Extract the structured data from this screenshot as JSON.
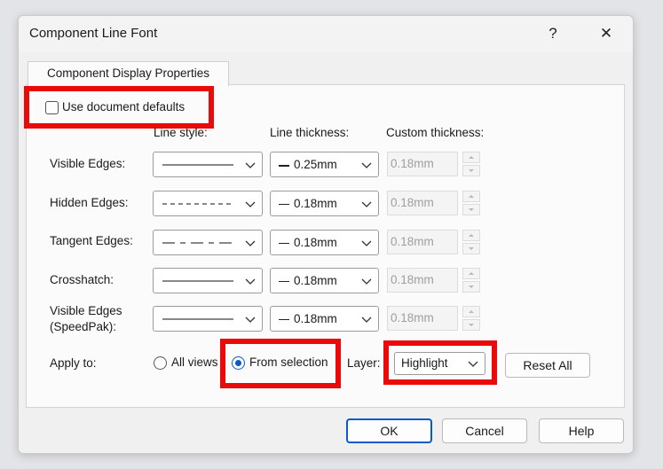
{
  "dialog": {
    "title": "Component Line Font",
    "help_glyph": "?",
    "close_glyph": "✕",
    "tab": "Component Display Properties",
    "use_defaults_label": "Use document defaults",
    "columns": {
      "line_style": "Line style:",
      "line_thickness": "Line thickness:",
      "custom_thickness": "Custom thickness:"
    },
    "rows": [
      {
        "label": "Visible Edges:",
        "style": "solid",
        "thickness": "0.25mm",
        "thick_mark": "thick",
        "custom": "0.18mm"
      },
      {
        "label": "Hidden Edges:",
        "style": "dashed",
        "thickness": "0.18mm",
        "thick_mark": "thin",
        "custom": "0.18mm"
      },
      {
        "label": "Tangent Edges:",
        "style": "dash-gap",
        "thickness": "0.18mm",
        "thick_mark": "thin",
        "custom": "0.18mm"
      },
      {
        "label": "Crosshatch:",
        "style": "solid",
        "thickness": "0.18mm",
        "thick_mark": "thin",
        "custom": "0.18mm"
      },
      {
        "label_line1": "Visible Edges",
        "label_line2": "(SpeedPak):",
        "style": "solid",
        "thickness": "0.18mm",
        "thick_mark": "thin",
        "custom": "0.18mm"
      }
    ],
    "apply_to": {
      "label": "Apply to:",
      "all_views": "All views",
      "from_selection": "From selection",
      "selected": "from_selection"
    },
    "layer": {
      "label": "Layer:",
      "value": "Highlight"
    },
    "reset_all": "Reset All",
    "buttons": {
      "ok": "OK",
      "cancel": "Cancel",
      "help": "Help"
    },
    "colors": {
      "accent": "#0a59c4",
      "highlight_box": "#ea0a0a"
    }
  },
  "icons": [
    "chevron-down-icon",
    "spin-up-icon",
    "spin-down-icon"
  ]
}
